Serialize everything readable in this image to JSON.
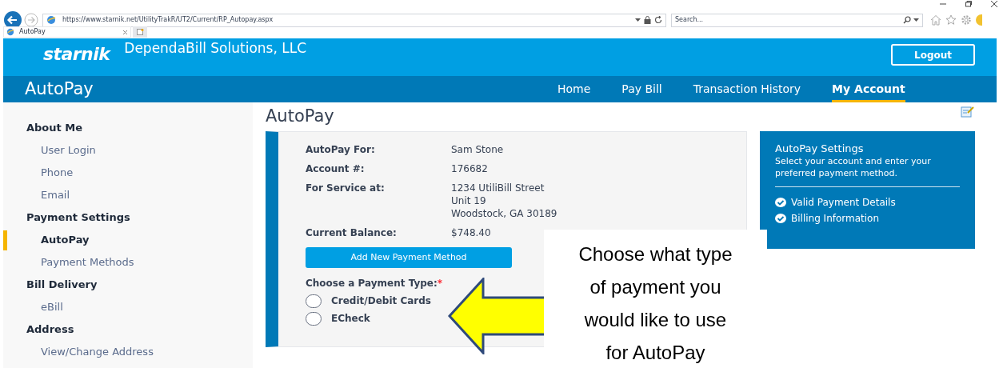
{
  "browser": {
    "url": "https://www.starnik.net/UtilityTrakR/UT2/Current/RP_Autopay.aspx",
    "search_placeholder": "Search...",
    "tab_title": "AutoPay"
  },
  "header": {
    "brand": "starnik",
    "company": "DependaBill Solutions, LLC",
    "logout": "Logout"
  },
  "page_title": "AutoPay",
  "nav": [
    {
      "label": "Home",
      "selected": false
    },
    {
      "label": "Pay Bill",
      "selected": false
    },
    {
      "label": "Transaction History",
      "selected": false
    },
    {
      "label": "My Account",
      "selected": true
    }
  ],
  "sidebar": [
    {
      "heading": "About Me",
      "items": [
        {
          "label": "User Login",
          "selected": false
        },
        {
          "label": "Phone",
          "selected": false
        },
        {
          "label": "Email",
          "selected": false
        }
      ]
    },
    {
      "heading": "Payment Settings",
      "items": [
        {
          "label": "AutoPay",
          "selected": true
        },
        {
          "label": "Payment Methods",
          "selected": false
        }
      ]
    },
    {
      "heading": "Bill Delivery",
      "items": [
        {
          "label": "eBill",
          "selected": false
        }
      ]
    },
    {
      "heading": "Address",
      "items": [
        {
          "label": "View/Change Address",
          "selected": false
        }
      ]
    }
  ],
  "content": {
    "title": "AutoPay",
    "details": [
      {
        "label": "AutoPay For:",
        "value": [
          "Sam Stone"
        ]
      },
      {
        "label": "Account #:",
        "value": [
          "176682"
        ]
      },
      {
        "label": "For Service at:",
        "value": [
          "1234 UtiliBill Street",
          "Unit 19",
          "Woodstock, GA 30189"
        ]
      },
      {
        "label": "Current Balance:",
        "value": [
          "$748.40"
        ]
      }
    ],
    "add_button": "Add New Payment Method",
    "payment_type": {
      "label": "Choose a Payment Type:",
      "required_mark": "*",
      "options": [
        {
          "label": "Credit/Debit Cards",
          "selected": false
        },
        {
          "label": "ECheck",
          "selected": false
        }
      ]
    }
  },
  "settings_panel": {
    "title": "AutoPay Settings",
    "description": "Select your account and enter your preferred payment method.",
    "checklist": [
      "Valid Payment Details",
      "Billing Information"
    ]
  },
  "annotation": {
    "text": "Choose what type of payment you would like to use for AutoPay"
  }
}
